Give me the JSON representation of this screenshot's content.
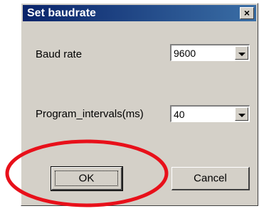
{
  "window": {
    "title": "Set baudrate",
    "close_label": "×"
  },
  "form": {
    "baud_rate_label": "Baud rate",
    "baud_rate_value": "9600",
    "interval_label": "Program_intervals(ms)",
    "interval_value": "40"
  },
  "buttons": {
    "ok_label": "OK",
    "cancel_label": "Cancel"
  },
  "colors": {
    "titlebar": "#0a246a",
    "dialog_bg": "#d4d0c8",
    "annotation": "#e8101a"
  },
  "icons": {
    "close": "close-icon",
    "dropdown": "chevron-down-icon"
  }
}
